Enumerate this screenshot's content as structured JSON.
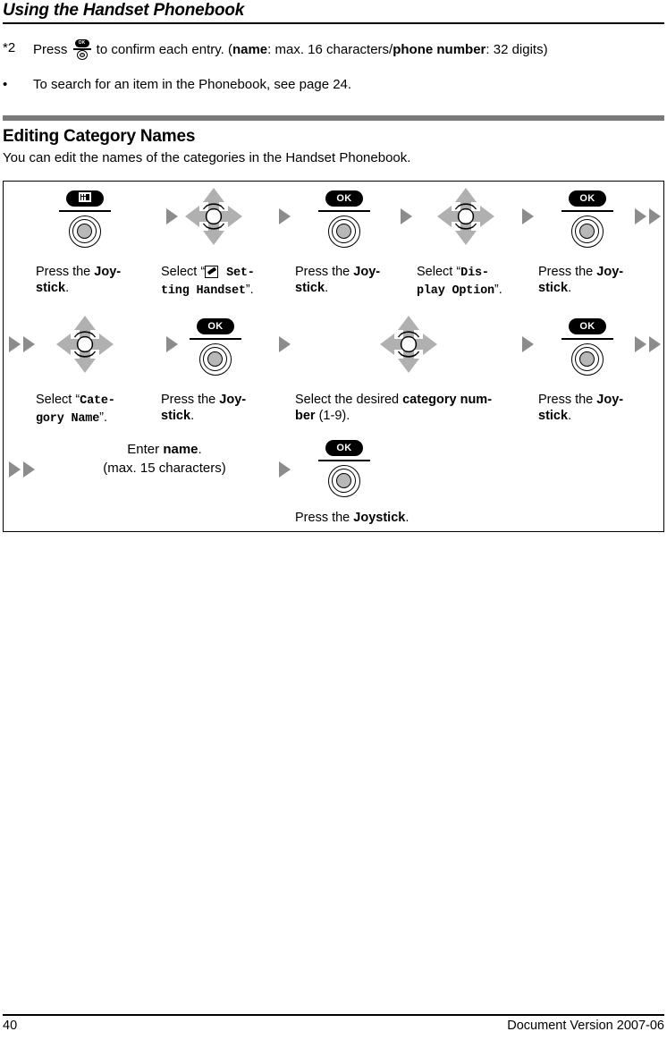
{
  "header": {
    "running_title": "Using the Handset Phonebook"
  },
  "notes": [
    {
      "marker": "*2",
      "parts": [
        {
          "t": "text",
          "v": "Press "
        },
        {
          "t": "icon",
          "v": "joystick-ok-icon",
          "label": "OK"
        },
        {
          "t": "text",
          "v": " to confirm each entry. ("
        },
        {
          "t": "bold",
          "v": "name"
        },
        {
          "t": "text",
          "v": ": max. 16 characters/"
        },
        {
          "t": "bold",
          "v": "phone number"
        },
        {
          "t": "text",
          "v": ": 32 digits)"
        }
      ],
      "plain": "Press [OK] to confirm each entry. (name: max. 16 characters/phone number: 32 digits)"
    },
    {
      "marker": "•",
      "plain": "To search for an item in the Phonebook, see page 24."
    }
  ],
  "section": {
    "title": "Editing Category Names",
    "subtitle": "You can edit the names of the categories in the Handset Phonebook.",
    "bar_color": "#7a7a7a"
  },
  "flow": {
    "rows": [
      {
        "lead": null,
        "trail": "double-arrow",
        "steps": [
          {
            "icon": "joystick-press-button",
            "badge": "menu-grid",
            "badge_label": "",
            "caption_parts": [
              {
                "t": "text",
                "v": "Press the "
              },
              {
                "t": "bold",
                "v": "Joy-"
              },
              {
                "t": "br"
              },
              {
                "t": "bold",
                "v": "stick"
              },
              {
                "t": "text",
                "v": "."
              }
            ],
            "caption_plain": "Press the Joystick."
          },
          {
            "icon": "nav-4way-icon",
            "caption_parts": [
              {
                "t": "text",
                "v": "Select “"
              },
              {
                "t": "icon",
                "v": "pencil-icon"
              },
              {
                "t": "mono",
                "v": " Set-"
              },
              {
                "t": "br"
              },
              {
                "t": "mono",
                "v": "ting Handset"
              },
              {
                "t": "text",
                "v": "”."
              }
            ],
            "caption_plain": "Select “[pencil] Setting Handset”."
          },
          {
            "icon": "joystick-press-button",
            "badge": "OK",
            "caption_parts": [
              {
                "t": "text",
                "v": "Press the "
              },
              {
                "t": "bold",
                "v": "Joy-"
              },
              {
                "t": "br"
              },
              {
                "t": "bold",
                "v": "stick"
              },
              {
                "t": "text",
                "v": "."
              }
            ],
            "caption_plain": "Press the Joystick."
          },
          {
            "icon": "nav-4way-icon",
            "caption_parts": [
              {
                "t": "text",
                "v": "Select “"
              },
              {
                "t": "mono",
                "v": "Dis-"
              },
              {
                "t": "br"
              },
              {
                "t": "mono",
                "v": "play Option"
              },
              {
                "t": "text",
                "v": "”."
              }
            ],
            "caption_plain": "Select “Display Option”."
          },
          {
            "icon": "joystick-press-button",
            "badge": "OK",
            "caption_parts": [
              {
                "t": "text",
                "v": "Press the "
              },
              {
                "t": "bold",
                "v": "Joy-"
              },
              {
                "t": "br"
              },
              {
                "t": "bold",
                "v": "stick"
              },
              {
                "t": "text",
                "v": "."
              }
            ],
            "caption_plain": "Press the Joystick."
          }
        ]
      },
      {
        "lead": "double-arrow",
        "trail": "double-arrow",
        "steps": [
          {
            "icon": "nav-4way-icon",
            "caption_parts": [
              {
                "t": "text",
                "v": "Select “"
              },
              {
                "t": "mono",
                "v": "Cate-"
              },
              {
                "t": "br"
              },
              {
                "t": "mono",
                "v": "gory Name"
              },
              {
                "t": "text",
                "v": "”."
              }
            ],
            "caption_plain": "Select “Category Name”."
          },
          {
            "icon": "joystick-press-button",
            "badge": "OK",
            "caption_parts": [
              {
                "t": "text",
                "v": "Press the "
              },
              {
                "t": "bold",
                "v": "Joy-"
              },
              {
                "t": "br"
              },
              {
                "t": "bold",
                "v": "stick"
              },
              {
                "t": "text",
                "v": "."
              }
            ],
            "caption_plain": "Press the Joystick."
          },
          {
            "icon": "nav-4way-icon",
            "caption_parts": [
              {
                "t": "text",
                "v": "Select the desired "
              },
              {
                "t": "bold",
                "v": "category num-"
              },
              {
                "t": "br"
              },
              {
                "t": "bold",
                "v": "ber"
              },
              {
                "t": "text",
                "v": " (1-9)."
              }
            ],
            "caption_plain": "Select the desired category number (1-9)."
          },
          {
            "icon": "joystick-press-button",
            "badge": "OK",
            "caption_parts": [
              {
                "t": "text",
                "v": "Press the "
              },
              {
                "t": "bold",
                "v": "Joy-"
              },
              {
                "t": "br"
              },
              {
                "t": "bold",
                "v": "stick"
              },
              {
                "t": "text",
                "v": "."
              }
            ],
            "caption_plain": "Press the Joystick."
          }
        ]
      },
      {
        "lead": "double-arrow",
        "trail": null,
        "steps": [
          {
            "icon": "text-only",
            "text_line1_parts": [
              {
                "t": "text",
                "v": "Enter "
              },
              {
                "t": "bold",
                "v": "name"
              },
              {
                "t": "text",
                "v": "."
              }
            ],
            "text_line1_plain": "Enter name.",
            "text_line2": "(max. 15 characters)"
          },
          {
            "icon": "joystick-press-button",
            "badge": "OK",
            "caption_parts": [
              {
                "t": "text",
                "v": "Press the "
              },
              {
                "t": "bold",
                "v": "Joystick"
              },
              {
                "t": "text",
                "v": "."
              }
            ],
            "caption_plain": "Press the Joystick."
          }
        ]
      }
    ]
  },
  "footer": {
    "page_number": "40",
    "document_version": "Document Version 2007-06"
  }
}
